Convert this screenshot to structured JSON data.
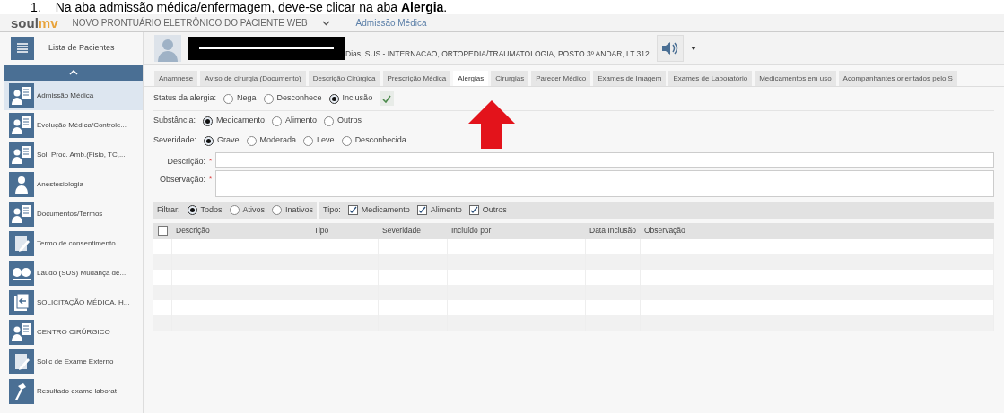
{
  "instruction": {
    "number": "1.",
    "text": "Na aba admissão médica/enfermagem, deve-se clicar na aba **Alergia**."
  },
  "header": {
    "logo": [
      {
        "text": "soul",
        "color": "#5a5a5a"
      },
      {
        "text": "mv",
        "color": "#e8a33a"
      }
    ],
    "title": "NOVO PRONTUÁRIO ELETRÔNICO DO PACIENTE WEB",
    "breadcrumb": "Admissão Médica"
  },
  "sidebar": {
    "top_item": "Lista de Pacientes",
    "items": [
      {
        "label": "Admissão Médica",
        "kind": "form",
        "selected": true
      },
      {
        "label": "Evolução Médica/Controle...",
        "kind": "form",
        "selected": false
      },
      {
        "label": "Sol. Proc. Amb.(Fisio, TC,...",
        "kind": "form",
        "selected": false
      },
      {
        "label": "Anestesiologia",
        "kind": "person",
        "selected": false
      },
      {
        "label": "Documentos/Termos",
        "kind": "form",
        "selected": false
      },
      {
        "label": "Termo de consentimento",
        "kind": "edit",
        "selected": false
      },
      {
        "label": "Laudo (SUS) Mudança de...",
        "kind": "report",
        "selected": false
      },
      {
        "label": "SOLICITAÇÃO MÉDICA, H...",
        "kind": "request",
        "selected": false
      },
      {
        "label": "CENTRO CIRÚRGICO",
        "kind": "form",
        "selected": false
      },
      {
        "label": "Solic de Exame Externo",
        "kind": "edit",
        "selected": false
      },
      {
        "label": "Resultado exame laborat",
        "kind": "result",
        "selected": false
      }
    ]
  },
  "patient": {
    "info": "Dias, SUS - INTERNACAO, ORTOPEDIA/TRAUMATOLOGIA, POSTO 3º ANDAR, LT 312"
  },
  "tabs": [
    {
      "label": "Anamnese",
      "selected": false
    },
    {
      "label": "Aviso de cirurgia (Documento)",
      "selected": false
    },
    {
      "label": "Descrição Cirúrgica",
      "selected": false
    },
    {
      "label": "Prescrição Médica",
      "selected": false
    },
    {
      "label": "Alergias",
      "selected": true
    },
    {
      "label": "Cirurgias",
      "selected": false
    },
    {
      "label": "Parecer Médico",
      "selected": false
    },
    {
      "label": "Exames de Imagem",
      "selected": false
    },
    {
      "label": "Exames de Laboratório",
      "selected": false
    },
    {
      "label": "Medicamentos em uso",
      "selected": false
    },
    {
      "label": "Acompanhantes orientados pelo S",
      "selected": false
    }
  ],
  "form": {
    "radio_groups": [
      {
        "label": "Status da alergia:",
        "options": [
          {
            "label": "Nega",
            "selected": false
          },
          {
            "label": "Desconhece",
            "selected": false
          },
          {
            "label": "Inclusão",
            "selected": true
          }
        ],
        "confirm": true
      },
      {
        "label": "Substância:",
        "options": [
          {
            "label": "Medicamento",
            "selected": true
          },
          {
            "label": "Alimento",
            "selected": false
          },
          {
            "label": "Outros",
            "selected": false
          }
        ]
      },
      {
        "label": "Severidade:",
        "options": [
          {
            "label": "Grave",
            "selected": true
          },
          {
            "label": "Moderada",
            "selected": false
          },
          {
            "label": "Leve",
            "selected": false
          },
          {
            "label": "Desconhecida",
            "selected": false
          }
        ]
      }
    ],
    "fields": [
      {
        "label": "Descrição:",
        "required_mark": "*",
        "kind": "line"
      },
      {
        "label": "Observação:",
        "required_mark": "*",
        "kind": "area"
      }
    ]
  },
  "filter": {
    "label": "Filtrar:",
    "options": [
      {
        "label": "Todos",
        "selected": true
      },
      {
        "label": "Ativos",
        "selected": false
      },
      {
        "label": "Inativos",
        "selected": false
      }
    ],
    "type_label": "Tipo:",
    "types": [
      {
        "label": "Medicamento",
        "checked": true
      },
      {
        "label": "Alimento",
        "checked": true
      },
      {
        "label": "Outros",
        "checked": true
      }
    ]
  },
  "table": {
    "select_all": false,
    "columns": [
      "Descrição",
      "Tipo",
      "Severidade",
      "Incluído por",
      "Data Inclusão",
      "Observação"
    ]
  }
}
